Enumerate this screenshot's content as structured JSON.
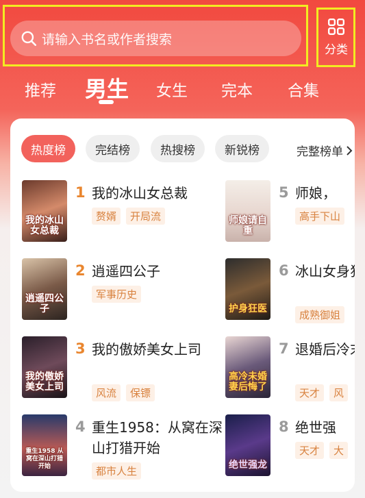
{
  "search": {
    "placeholder": "请输入书名或作者搜索"
  },
  "category": {
    "label": "分类"
  },
  "tabs": [
    {
      "label": "推荐"
    },
    {
      "label": "男生"
    },
    {
      "label": "女生"
    },
    {
      "label": "完本"
    },
    {
      "label": "合集"
    }
  ],
  "active_tab": "男生",
  "chips": [
    {
      "label": "热度榜"
    },
    {
      "label": "完结榜"
    },
    {
      "label": "热搜榜"
    },
    {
      "label": "新锐榜"
    }
  ],
  "full_list_label": "完整榜单",
  "colors": {
    "accent": "#f2625c",
    "rank_top": "#e9862f",
    "rank_other": "#9a9a9a",
    "tag_text": "#d8823f",
    "tag_bg": "#fdf0e6",
    "highlight": "#f2ec21"
  },
  "books": [
    {
      "rank": "1",
      "title": "我的冰山女总裁",
      "tags": [
        "赘婿",
        "开局流"
      ],
      "cover_text": "我的冰山女总裁"
    },
    {
      "rank": "2",
      "title": "逍遥四公子",
      "tags": [
        "军事历史"
      ],
      "cover_text": "逍遥四公子"
    },
    {
      "rank": "3",
      "title": "我的傲娇美女上司",
      "tags": [
        "风流",
        "保镖"
      ],
      "cover_text": "我的傲娇美女上司"
    },
    {
      "rank": "4",
      "title": "重生1958：从窝在深山打猎开始",
      "tags": [
        "都市人生"
      ],
      "cover_text": "重生1958 从窝在深山打猎开始"
    },
    {
      "rank": "5",
      "title": "师娘，",
      "tags": [
        "高手下山"
      ],
      "cover_text": "师娘请自重"
    },
    {
      "rank": "6",
      "title": "冰山女身狂医",
      "tags": [
        "成熟御姐"
      ],
      "cover_text": "护身狂医"
    },
    {
      "rank": "7",
      "title": "退婚后冷末婚",
      "tags": [
        "天才",
        "风"
      ],
      "cover_text": "高冷未婚妻后悔了"
    },
    {
      "rank": "8",
      "title": "绝世强",
      "tags": [
        "天才",
        "大"
      ],
      "cover_text": "绝世强龙"
    }
  ]
}
